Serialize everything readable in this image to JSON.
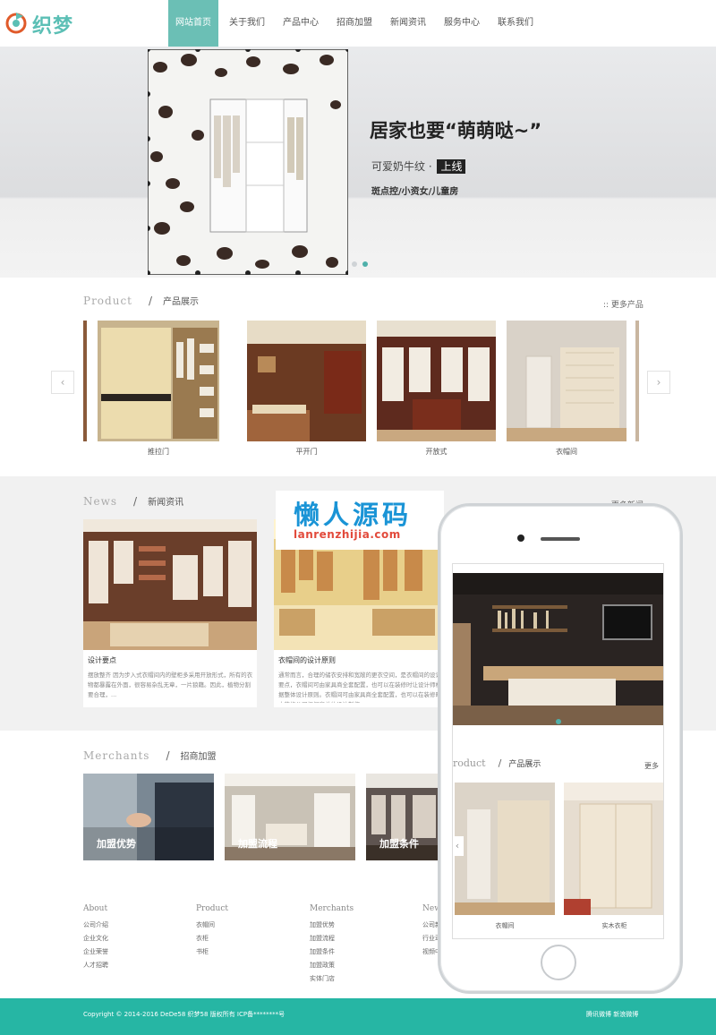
{
  "header": {
    "logo_text": "织梦",
    "nav": [
      "网站首页",
      "关于我们",
      "产品中心",
      "招商加盟",
      "新闻资讯",
      "服务中心",
      "联系我们"
    ],
    "active_index": 0
  },
  "banner": {
    "headline": "居家也要“萌萌哒~”",
    "sub_text": "可爱奶牛纹 ·",
    "sub_tag": "上线",
    "tagline": "斑点控/小资女/儿童房",
    "slides": 2,
    "active_slide": 1
  },
  "product": {
    "en": "Product",
    "cn": "产品展示",
    "more": ":: 更多产品",
    "prev": "‹",
    "next": "›",
    "items": [
      "推拉门",
      "平开门",
      "开放式",
      "衣帽间"
    ]
  },
  "news": {
    "en": "News",
    "cn": "新闻资讯",
    "more": ":: 更多新闻",
    "items": [
      {
        "title": "设计要点",
        "desc": "摆放整齐 因为步入式衣帽间内的壁柜多采用开放形式，所有的衣物都暴露在外面，很容易杂乱无章，一片狼藉。因此，植物分割要合理，..."
      },
      {
        "title": "衣帽间的设计原则",
        "desc": "通常而言，合理的储衣安排和宽敞的更衣空间，是衣帽间的设计要点，衣帽间可由家具商全套配置，也可以在装修时让设计师根据整体设计原则。衣帽间可由家具商全套配置，也可以在装修时由装修公司根据房总体设计制作..."
      }
    ]
  },
  "merchants": {
    "en": "Merchants",
    "cn": "招商加盟",
    "items": [
      "加盟优势",
      "加盟流程",
      "加盟条件"
    ]
  },
  "footer": {
    "cols": [
      {
        "h": "About",
        "links": [
          "公司介绍",
          "企业文化",
          "企业荣誉",
          "人才招聘"
        ]
      },
      {
        "h": "Product",
        "links": [
          "衣帽间",
          "衣柜",
          "书柜"
        ]
      },
      {
        "h": "Merchants",
        "links": [
          "加盟优势",
          "加盟流程",
          "加盟条件",
          "加盟政策",
          "实体门店"
        ]
      },
      {
        "h": "New",
        "links": [
          "公司新",
          "行业动",
          "视频中"
        ]
      }
    ],
    "copyright": "Copyright © 2014-2016 DeDe58 织梦58 版权所有  ICP备********号",
    "social": "腾讯微博  新浪微博"
  },
  "watermark": {
    "cn": "懒人源码",
    "url": "lanrenzhijia.com"
  },
  "phone": {
    "product_en": "roduct",
    "product_cn": "产品展示",
    "more": "更多",
    "items": [
      "衣帽间",
      "实木衣柜"
    ],
    "prev": "‹"
  },
  "colors": {
    "accent": "#26b6a4",
    "nav_active": "#6bbfb5",
    "watermark_blue": "#1a94d6",
    "watermark_red": "#e24a3b"
  }
}
